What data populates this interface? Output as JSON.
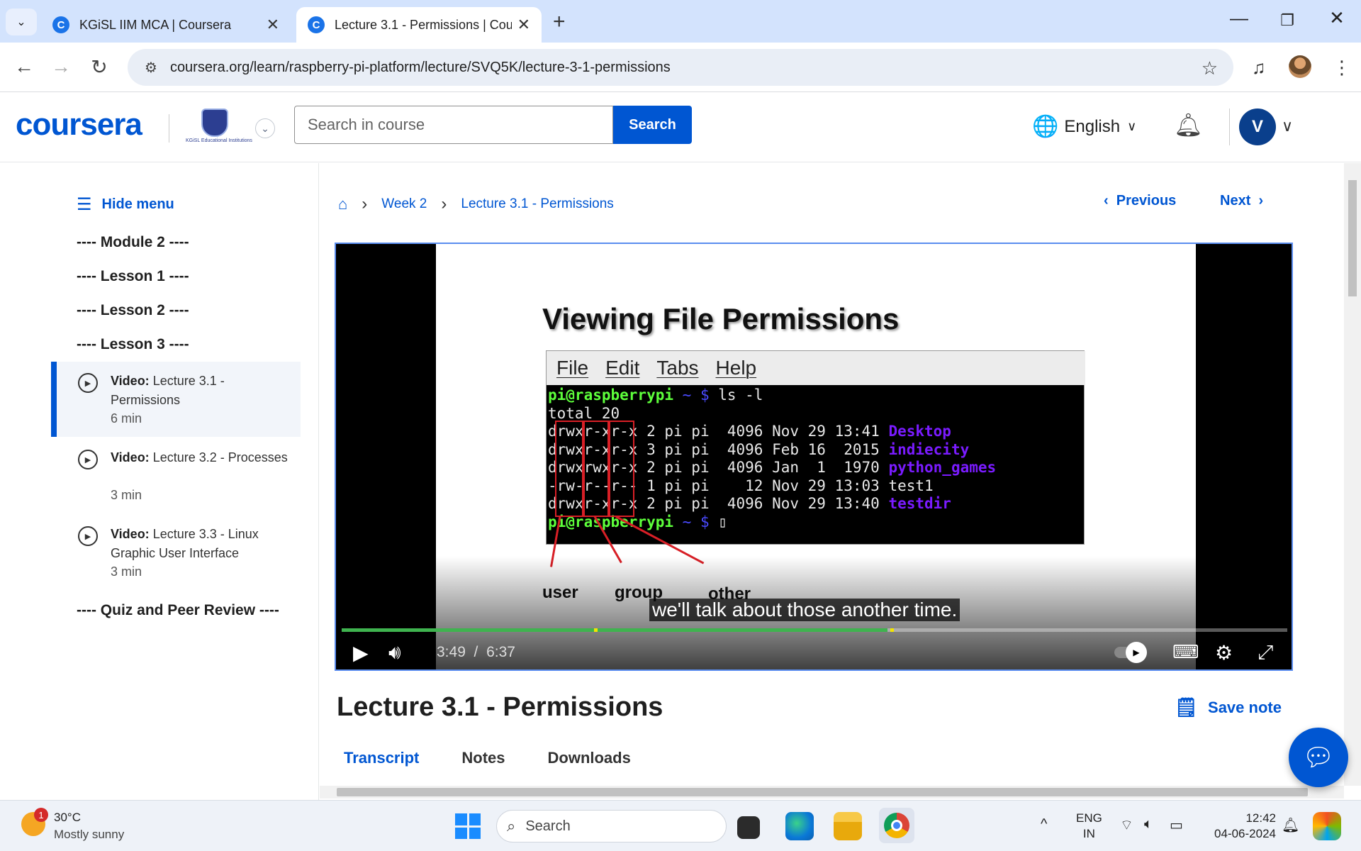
{
  "browser": {
    "tabs": [
      {
        "title": "KGiSL IIM MCA | Coursera",
        "active": false
      },
      {
        "title": "Lecture 3.1 - Permissions | Coursera",
        "active": true
      }
    ],
    "url": "coursera.org/learn/raspberry-pi-platform/lecture/SVQ5K/lecture-3-1-permissions"
  },
  "header": {
    "logo": "coursera",
    "institution_text": "KGiSL Educational Institutions",
    "search_placeholder": "Search in course",
    "search_button": "Search",
    "language": "English",
    "avatar_initial": "V"
  },
  "sidebar": {
    "hide_menu": "Hide menu",
    "headings": [
      "---- Module 2 ----",
      "---- Lesson 1 ----",
      "---- Lesson 2 ----",
      "---- Lesson 3 ----"
    ],
    "items": [
      {
        "type": "Video:",
        "title": "Lecture 3.1 - Permissions",
        "duration": "6 min",
        "active": true
      },
      {
        "type": "Video:",
        "title": "Lecture 3.2 - Processes",
        "duration": "3 min",
        "active": false
      },
      {
        "type": "Video:",
        "title": "Lecture 3.3 - Linux Graphic User Interface",
        "duration": "3 min",
        "active": false
      }
    ],
    "quiz_heading": "---- Quiz and Peer Review ----"
  },
  "breadcrumb": {
    "week": "Week 2",
    "lecture": "Lecture 3.1 - Permissions"
  },
  "nav": {
    "previous": "Previous",
    "next": "Next"
  },
  "video": {
    "slide_title": "Viewing File Permissions",
    "terminal_menu": [
      "File",
      "Edit",
      "Tabs",
      "Help"
    ],
    "terminal": {
      "prompt": "pi@raspberrypi",
      "prompt_suffix": " ~ $ ",
      "command": "ls -l",
      "total": "total 20",
      "rows": [
        {
          "perm": "drwxr-xr-x",
          "info": " 2 pi pi  4096 Nov 29 13:41 ",
          "name": "Desktop",
          "dir": true
        },
        {
          "perm": "drwxr-xr-x",
          "info": " 3 pi pi  4096 Feb 16  2015 ",
          "name": "indiecity",
          "dir": true
        },
        {
          "perm": "drwxrwxr-x",
          "info": " 2 pi pi  4096 Jan  1  1970 ",
          "name": "python_games",
          "dir": true
        },
        {
          "perm": "-rw-r--r--",
          "info": " 1 pi pi    12 Nov 29 13:03 ",
          "name": "test1",
          "dir": false
        },
        {
          "perm": "drwxr-xr-x",
          "info": " 2 pi pi  4096 Nov 29 13:40 ",
          "name": "testdir",
          "dir": true
        }
      ]
    },
    "labels": {
      "user": "user",
      "group": "group",
      "other": "other"
    },
    "caption": "we'll talk about those another time.",
    "current_time": "3:49",
    "total_time": "6:37",
    "time_separator": "/",
    "progress": 0.577,
    "chapter_marks": [
      0.267,
      0.58
    ]
  },
  "lecture": {
    "title": "Lecture 3.1 - Permissions",
    "save_note": "Save note",
    "tabs": [
      "Transcript",
      "Notes",
      "Downloads"
    ]
  },
  "taskbar": {
    "weather_temp": "30°C",
    "weather_desc": "Mostly sunny",
    "weather_badge": "1",
    "search": "Search",
    "lang_line1": "ENG",
    "lang_line2": "IN",
    "time": "12:42",
    "date": "04-06-2024"
  }
}
